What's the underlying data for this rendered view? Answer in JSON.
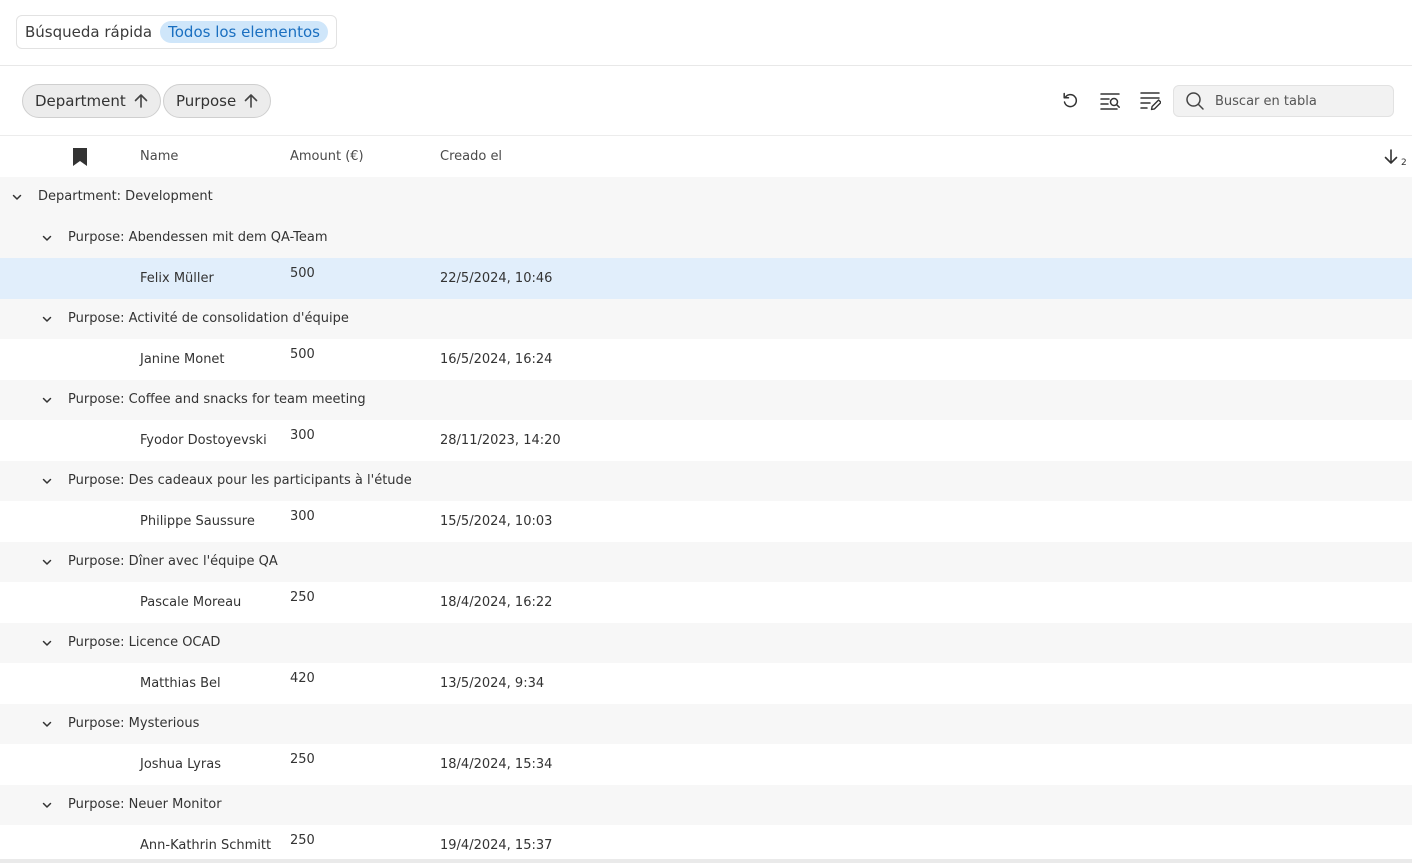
{
  "quick_search": {
    "label": "Búsqueda rápida",
    "filter": "Todos los elementos"
  },
  "toolbar": {
    "group_chips": [
      {
        "label": "Department",
        "icon": "arrow-up-icon"
      },
      {
        "label": "Purpose",
        "icon": "arrow-up-icon"
      }
    ],
    "buttons": [
      "reset-icon",
      "search-filter-icon",
      "edit-list-icon"
    ],
    "search": {
      "placeholder": "Buscar en tabla",
      "value": ""
    }
  },
  "table": {
    "columns": [
      "Name",
      "Amount (€)",
      "Creado el"
    ],
    "sort_count": "2",
    "department_group": "Department: Development",
    "groups": [
      {
        "label": "Purpose: Abendessen mit dem QA-Team",
        "rows": [
          {
            "name": "Felix Müller",
            "amount": "500",
            "created": "22/5/2024, 10:46",
            "selected": true
          }
        ]
      },
      {
        "label": "Purpose: Activité de consolidation d'équipe",
        "rows": [
          {
            "name": "Janine Monet",
            "amount": "500",
            "created": "16/5/2024, 16:24"
          }
        ]
      },
      {
        "label": "Purpose: Coffee and snacks for team meeting",
        "rows": [
          {
            "name": "Fyodor Dostoyevski",
            "amount": "300",
            "created": "28/11/2023, 14:20"
          }
        ]
      },
      {
        "label": "Purpose: Des cadeaux pour les participants à l'étude",
        "rows": [
          {
            "name": "Philippe Saussure",
            "amount": "300",
            "created": "15/5/2024, 10:03"
          }
        ]
      },
      {
        "label": "Purpose: Dîner avec l'équipe QA",
        "rows": [
          {
            "name": "Pascale Moreau",
            "amount": "250",
            "created": "18/4/2024, 16:22"
          }
        ]
      },
      {
        "label": "Purpose: Licence OCAD",
        "rows": [
          {
            "name": "Matthias Bel",
            "amount": "420",
            "created": "13/5/2024, 9:34"
          }
        ]
      },
      {
        "label": "Purpose: Mysterious",
        "rows": [
          {
            "name": "Joshua Lyras",
            "amount": "250",
            "created": "18/4/2024, 15:34"
          }
        ]
      },
      {
        "label": "Purpose: Neuer Monitor",
        "rows": [
          {
            "name": "Ann-Kathrin Schmitt",
            "amount": "250",
            "created": "19/4/2024, 15:37"
          }
        ]
      }
    ]
  },
  "colors": {
    "selected_row": "#e1eefb",
    "group_row": "#f7f7f7",
    "pill_bg": "#cfe6fa",
    "pill_text": "#1a6fc0"
  }
}
